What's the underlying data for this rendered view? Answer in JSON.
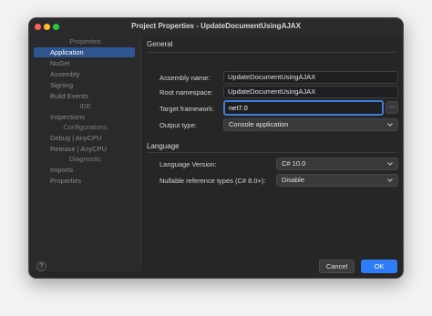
{
  "window": {
    "title": "Project Properties - UpdateDocumentUsingAJAX"
  },
  "sidebar": {
    "sections": [
      {
        "header": "Properties",
        "items": [
          {
            "label": "Application",
            "active": true
          },
          {
            "label": "NuGet"
          },
          {
            "label": "Assembly"
          },
          {
            "label": "Signing"
          },
          {
            "label": "Build Events"
          }
        ]
      },
      {
        "header": "IDE",
        "items": [
          {
            "label": "Inspections"
          }
        ]
      },
      {
        "header": "Configurations",
        "items": [
          {
            "label": "Debug | AnyCPU"
          },
          {
            "label": "Release | AnyCPU"
          }
        ]
      },
      {
        "header": "Diagnostic",
        "items": [
          {
            "label": "Imports"
          },
          {
            "label": "Properties"
          }
        ]
      }
    ]
  },
  "general": {
    "title": "General",
    "assembly_name": {
      "label": "Assembly name:",
      "value": "UpdateDocumentUsingAJAX"
    },
    "root_namespace": {
      "label": "Root namespace:",
      "value": "UpdateDocumentUsingAJAX"
    },
    "target_framework": {
      "label": "Target framework:",
      "value": "net7.0",
      "browse": "..."
    },
    "output_type": {
      "label": "Output type:",
      "value": "Console application"
    }
  },
  "language": {
    "title": "Language",
    "version": {
      "label": "Language Version:",
      "value": "C# 10.0"
    },
    "nullable": {
      "label": "Nullable reference types (C# 8.0+):",
      "value": "Disable"
    }
  },
  "footer": {
    "help": "?",
    "cancel": "Cancel",
    "ok": "OK"
  },
  "colors": {
    "accent": "#2f7cf6",
    "selection": "#2f5691",
    "background": "#262627"
  }
}
